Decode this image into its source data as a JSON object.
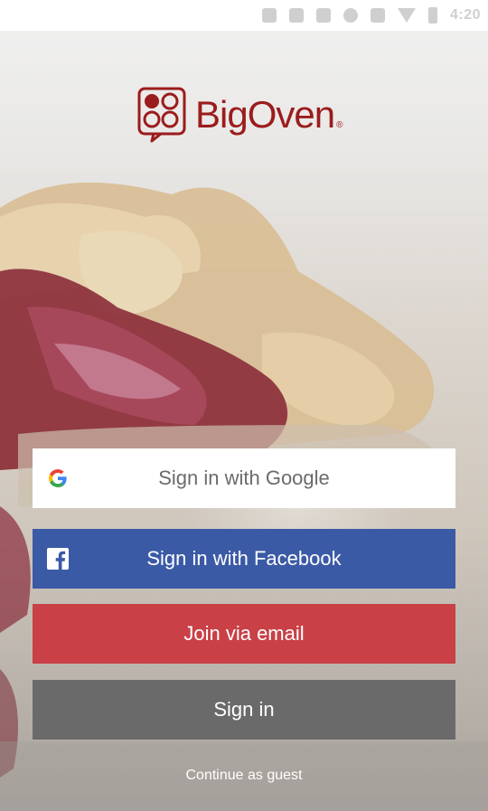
{
  "status_bar": {
    "time": "4:20",
    "icons": [
      "notification-icon",
      "download-icon",
      "game-icon",
      "alarm-icon",
      "lock-icon",
      "wifi-icon",
      "battery-icon"
    ]
  },
  "logo": {
    "text": "BigOven",
    "registered": "®",
    "color": "#9b1c1c"
  },
  "buttons": {
    "google": {
      "label": "Sign in with Google",
      "icon": "google-icon",
      "bg": "#ffffff"
    },
    "facebook": {
      "label": "Sign in with Facebook",
      "icon": "facebook-icon",
      "bg": "#3b5aa6"
    },
    "email": {
      "label": "Join via email",
      "bg": "#c94046"
    },
    "signin": {
      "label": "Sign in",
      "bg": "#6a6a6a"
    }
  },
  "guest_link": {
    "label": "Continue as guest"
  }
}
